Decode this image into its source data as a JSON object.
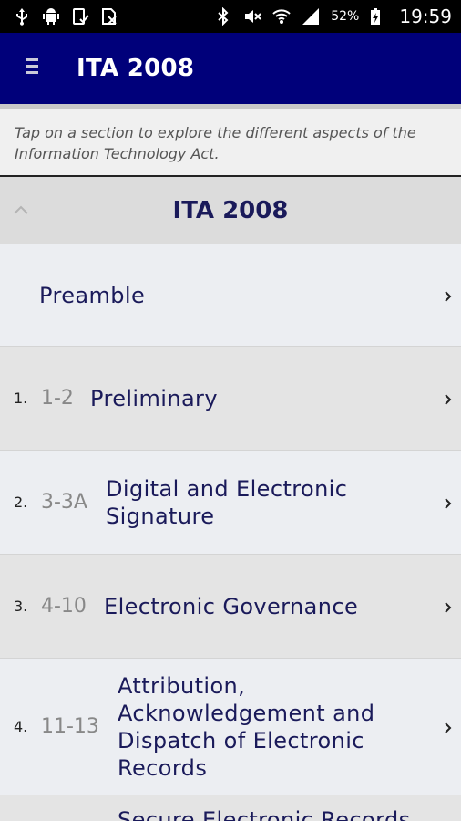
{
  "status_bar": {
    "battery_percent": "52%",
    "time": "19:59",
    "left_icons": [
      "usb-icon",
      "android-debug-icon",
      "device-check-icon",
      "sim-off-icon"
    ],
    "right_icons": [
      "bluetooth-icon",
      "mute-icon",
      "wifi-icon",
      "signal-icon",
      "battery-icon"
    ]
  },
  "app_bar": {
    "title": "ITA 2008",
    "menu_icon": "hamburger-menu-icon"
  },
  "hint_text": "Tap on a section to explore the different aspects of the Information Technology Act.",
  "section": {
    "title": "ITA 2008",
    "collapse_icon": "chevron-up-icon"
  },
  "rows": [
    {
      "num": "",
      "range": "",
      "title": "Preamble"
    },
    {
      "num": "1.",
      "range": "1-2",
      "title": "Preliminary"
    },
    {
      "num": "2.",
      "range": "3-3A",
      "title": "Digital and Electronic Signature"
    },
    {
      "num": "3.",
      "range": "4-10",
      "title": "Electronic Governance"
    },
    {
      "num": "4.",
      "range": "11-13",
      "title": "Attribution, Acknowledgement and Dispatch of Electronic Records"
    },
    {
      "num": "",
      "range": "",
      "title": "Secure Electronic Records"
    }
  ],
  "colors": {
    "app_bar": "#00007a",
    "title_text": "#1a1a5a",
    "range_text": "#888888"
  }
}
